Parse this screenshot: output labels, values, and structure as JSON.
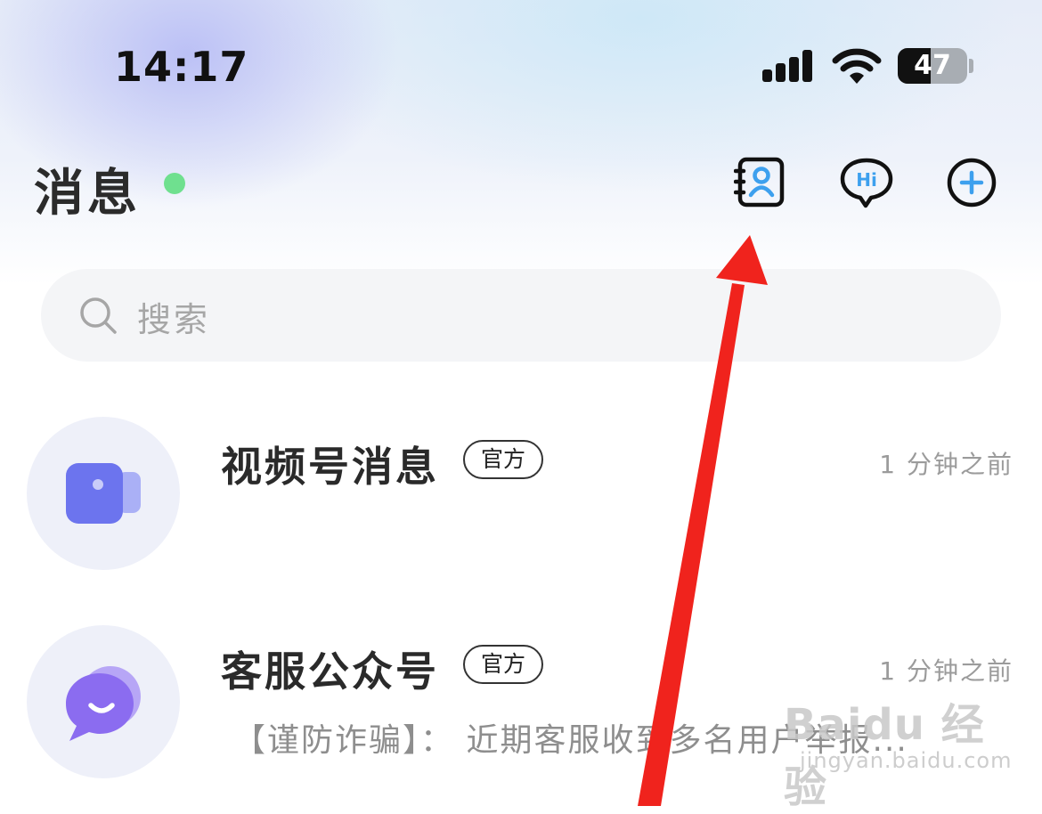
{
  "status_bar": {
    "time": "14:17",
    "battery_level": "47"
  },
  "header": {
    "title": "消息",
    "online_indicator_color": "#6fe08f",
    "actions": [
      {
        "icon": "contacts-book-icon"
      },
      {
        "icon": "hi-chat-bubble-icon"
      },
      {
        "icon": "plus-circle-icon"
      }
    ]
  },
  "search": {
    "placeholder": "搜索",
    "icon": "search-icon"
  },
  "conversations": [
    {
      "name": "视频号消息",
      "badge": "官方",
      "time": "1 分钟之前",
      "preview": "",
      "avatar_icon": "video-camera-icon",
      "avatar_color": "#6c74ee"
    },
    {
      "name": "客服公众号",
      "badge": "官方",
      "time": "1 分钟之前",
      "preview": "【谨防诈骗】： 近期客服收到多名用户举报...",
      "avatar_icon": "smile-chat-bubble-icon",
      "avatar_color": "#8b6cf0"
    }
  ],
  "annotation": {
    "arrow_color": "#f0231d"
  },
  "watermark": {
    "brand": "Baidu 经验",
    "url": "jingyan.baidu.com"
  }
}
